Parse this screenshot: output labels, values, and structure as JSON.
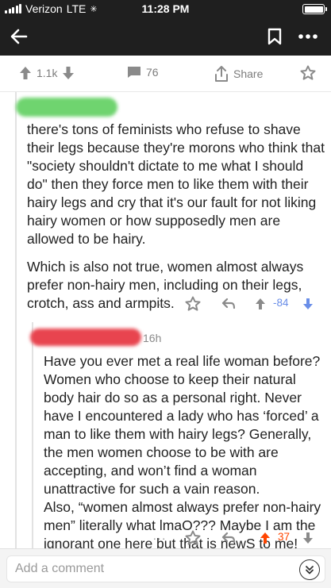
{
  "status_bar": {
    "carrier": "Verizon",
    "network": "LTE",
    "time": "11:28 PM"
  },
  "nav": {
    "back_icon": "arrow-left-icon",
    "save_icon": "bookmark-icon",
    "more_icon": "more-icon"
  },
  "post_bar": {
    "upvotes": "1.1k",
    "comments": "76",
    "share_label": "Share"
  },
  "comment1": {
    "paragraphs": [
      "there's tons of feminists who refuse to shave their legs because they're morons who think that \"society shouldn't dictate to me what I should do\" then they force men to like them with their hairy legs and cry that it's our fault for not liking hairy women or how supposedly men are allowed to be hairy.",
      "Which is also not true, women almost always prefer non-hairy men, including on their legs, crotch, ass and armpits."
    ],
    "score": "-84",
    "more_label": "···"
  },
  "comment2": {
    "time_ago": "16h",
    "lines": [
      "Have you ever met a real life woman before?",
      "Women who choose to keep their natural",
      "body hair do so as a personal right. Never",
      "have I encountered a lady who has ‘forced’ a",
      "man to like them with hairy legs? Generally,",
      "the men women choose to be with are",
      "accepting, and won’t find a woman",
      "unattractive for such a vain reason.",
      "Also, “women almost always prefer non-hairy",
      "men” literally what lmaO??? Maybe I am the",
      "ignorant one here but that is newS to me!"
    ],
    "score": "37",
    "more_label": "···"
  },
  "bottom_bar": {
    "comment_placeholder": "Add a comment"
  },
  "colors": {
    "username1_blur": "#6fd46f",
    "username2_blur": "#e8444f",
    "downvote_blue": "#6a8ee8",
    "upvote_orange": "#ff4500",
    "header_dark": "#1f1f1f"
  }
}
